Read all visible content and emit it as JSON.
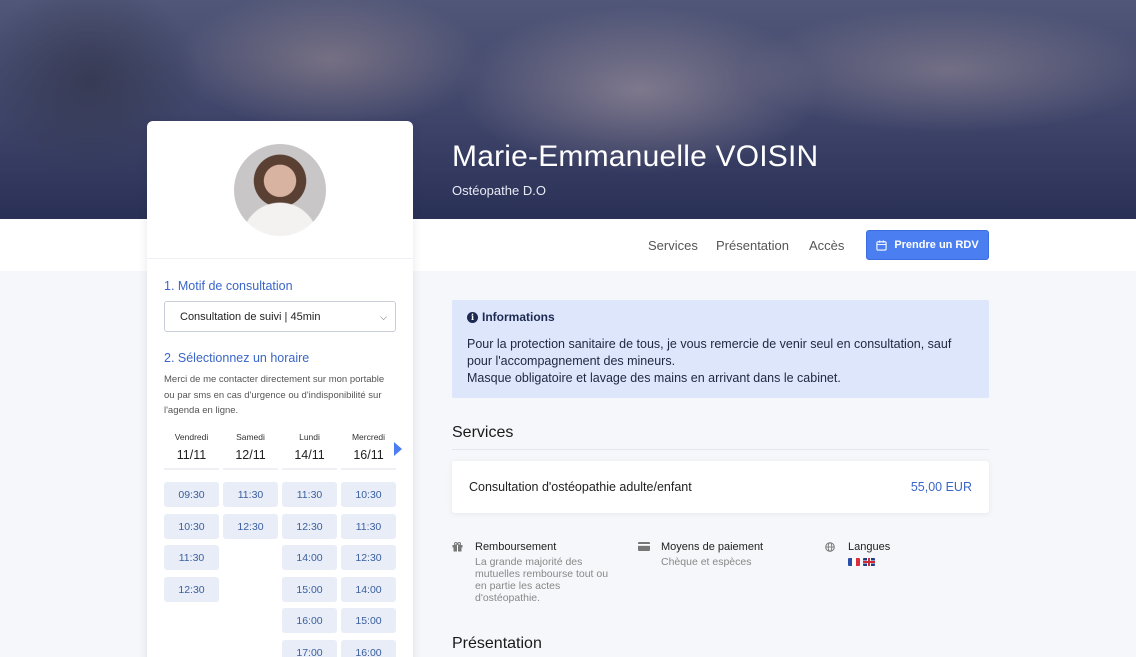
{
  "hero": {
    "name": "Marie-Emmanuelle VOISIN",
    "subtitle": "Ostéopathe D.O"
  },
  "nav": {
    "links": [
      "Services",
      "Présentation",
      "Accès"
    ],
    "cta_label": "Prendre un RDV",
    "cta_icon": "calendar-icon"
  },
  "booking": {
    "step1_title": "1. Motif de consultation",
    "select_value": "Consultation de suivi | 45min",
    "step2_title": "2. Sélectionnez un horaire",
    "note": "Merci de me contacter directement sur mon portable ou par sms en cas d'urgence ou d'indisponibilité sur l'agenda en ligne.",
    "days": [
      {
        "name": "Vendredi",
        "date": "11/11",
        "slots": [
          "09:30",
          "10:30",
          "11:30",
          "12:30"
        ]
      },
      {
        "name": "Samedi",
        "date": "12/11",
        "slots": [
          "11:30",
          "12:30"
        ]
      },
      {
        "name": "Lundi",
        "date": "14/11",
        "slots": [
          "11:30",
          "12:30",
          "14:00",
          "15:00",
          "16:00",
          "17:00"
        ]
      },
      {
        "name": "Mercredi",
        "date": "16/11",
        "slots": [
          "10:30",
          "11:30",
          "12:30",
          "14:00",
          "15:00",
          "16:00"
        ]
      }
    ]
  },
  "info": {
    "title": "Informations",
    "line1": "Pour la protection sanitaire de tous, je vous remercie de venir seul en consultation, sauf pour l'accompagnement des mineurs.",
    "line2": "Masque obligatoire et lavage des mains en arrivant dans le cabinet."
  },
  "services": {
    "title": "Services",
    "items": [
      {
        "name": "Consultation d'ostéopathie adulte/enfant",
        "price": "55,00 EUR"
      }
    ]
  },
  "features": {
    "reimbursement": {
      "title": "Remboursement",
      "text": "La grande majorité des mutuelles rembourse tout ou en partie les actes d'ostéopathie.",
      "icon": "gift-icon"
    },
    "payment": {
      "title": "Moyens de paiement",
      "text": "Chèque et espèces",
      "icon": "credit-card-icon"
    },
    "languages": {
      "title": "Langues",
      "icon": "globe-icon",
      "flags": [
        "fr",
        "en"
      ]
    }
  },
  "presentation": {
    "title": "Présentation"
  },
  "colors": {
    "accent": "#4b7ef0",
    "link_blue": "#3a66c8",
    "info_bg": "#dde6fa",
    "slot_bg": "#e8edf8"
  }
}
